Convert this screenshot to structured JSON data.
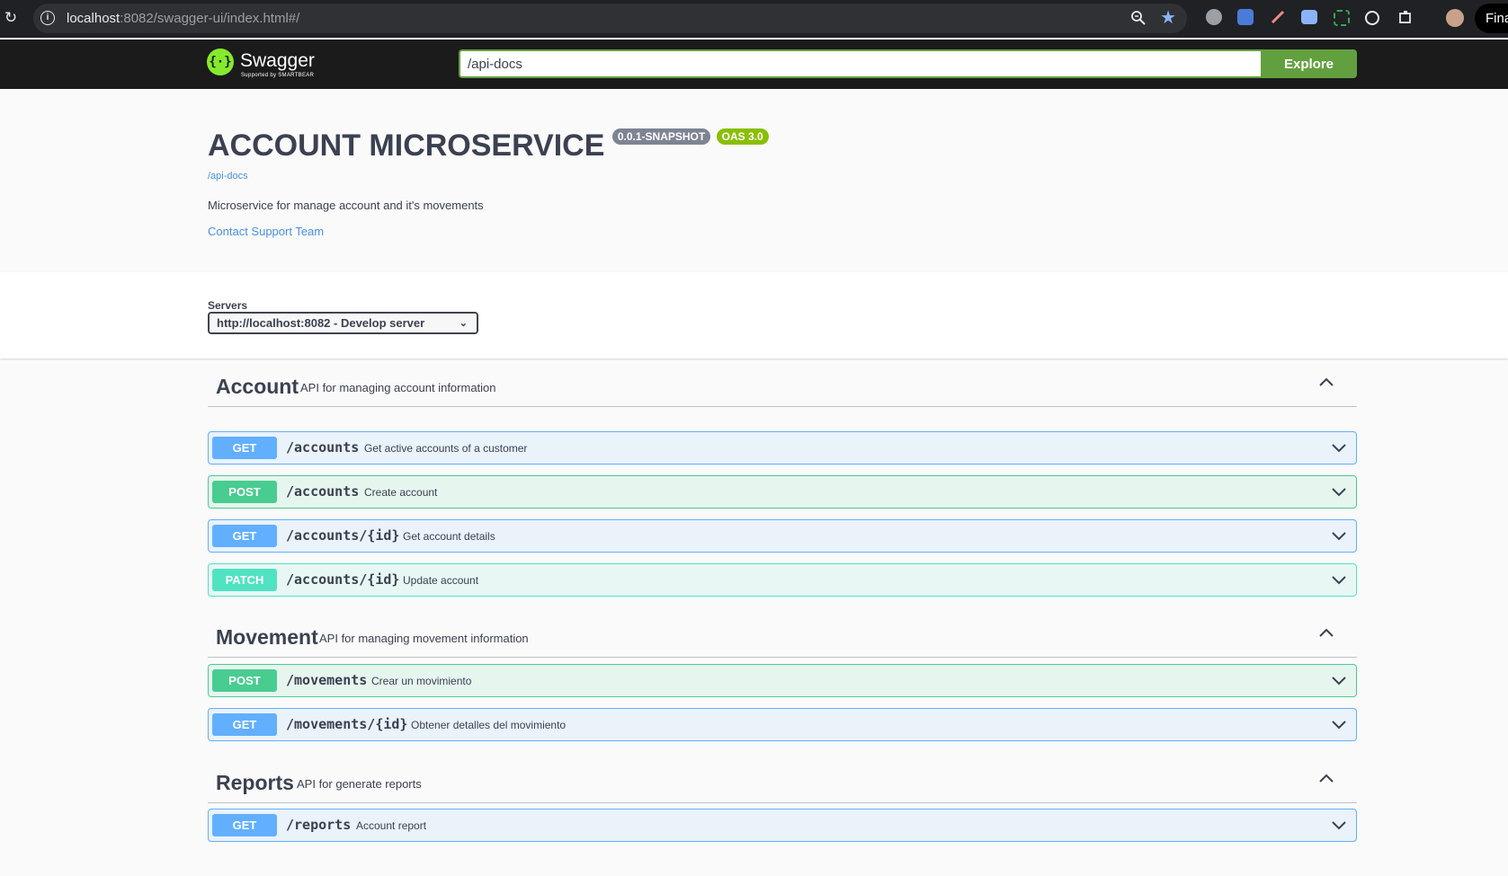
{
  "browser": {
    "url_host": "localhost",
    "url_rest": ":8082/swagger-ui/index.html#/",
    "profile_label": "Fina"
  },
  "topbar": {
    "logo_text": "Swagger",
    "logo_sub": "Supported by SMARTBEAR",
    "url_value": "/api-docs",
    "explore_label": "Explore"
  },
  "info": {
    "title": "ACCOUNT MICROSERVICE",
    "version_badge": "0.0.1-SNAPSHOT",
    "oas_badge": "OAS 3.0",
    "api_url": "/api-docs",
    "description": "Microservice for manage account and it's movements",
    "contact": "Contact Support Team"
  },
  "servers": {
    "label": "Servers",
    "selected": "http://localhost:8082 - Develop server"
  },
  "tags": [
    {
      "name": "Account",
      "description": "API for managing account information",
      "operations": [
        {
          "method": "GET",
          "path": "/accounts",
          "summary": "Get active accounts of a customer"
        },
        {
          "method": "POST",
          "path": "/accounts",
          "summary": "Create account"
        },
        {
          "method": "GET",
          "path": "/accounts/{id}",
          "summary": "Get account details"
        },
        {
          "method": "PATCH",
          "path": "/accounts/{id}",
          "summary": "Update account"
        }
      ]
    },
    {
      "name": "Movement",
      "description": "API for managing movement information",
      "operations": [
        {
          "method": "POST",
          "path": "/movements",
          "summary": "Crear un movimiento"
        },
        {
          "method": "GET",
          "path": "/movements/{id}",
          "summary": "Obtener detalles del movimiento"
        }
      ]
    },
    {
      "name": "Reports",
      "description": "API for generate reports",
      "operations": [
        {
          "method": "GET",
          "path": "/reports",
          "summary": "Account report"
        }
      ]
    }
  ],
  "colors": {
    "get": "#61affe",
    "post": "#49cc90",
    "patch": "#50e3c2",
    "explore": "#62a03f",
    "link": "#4990e2"
  }
}
